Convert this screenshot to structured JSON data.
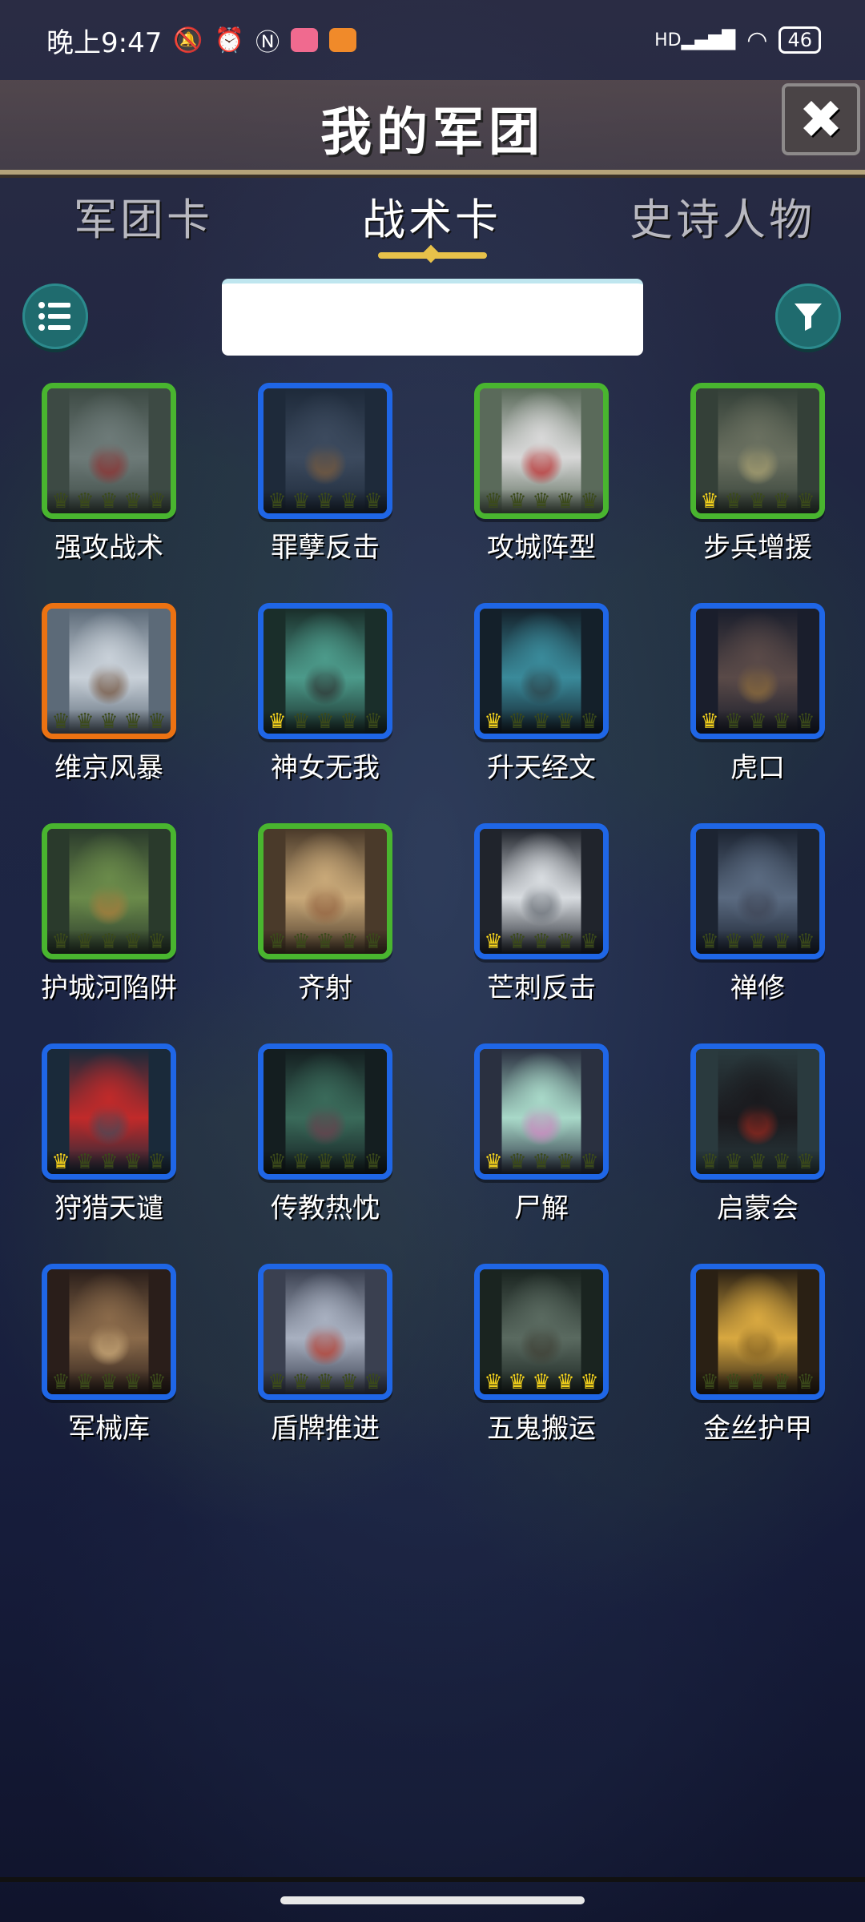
{
  "status_bar": {
    "time": "晚上9:47",
    "battery": "46",
    "network": "HD"
  },
  "header": {
    "title": "我的军团",
    "close_label": "✖"
  },
  "tabs": [
    {
      "label": "军团卡",
      "active": false
    },
    {
      "label": "战术卡",
      "active": true
    },
    {
      "label": "史诗人物",
      "active": false
    }
  ],
  "search": {
    "value": "",
    "placeholder": ""
  },
  "cards": [
    {
      "label": "强攻战术",
      "frame": "green",
      "gold_crowns": 0,
      "art": "knights-banner"
    },
    {
      "label": "罪孽反击",
      "frame": "blue",
      "gold_crowns": 0,
      "art": "dark-soldiers"
    },
    {
      "label": "攻城阵型",
      "frame": "green",
      "gold_crowns": 0,
      "art": "crusader"
    },
    {
      "label": "步兵增援",
      "frame": "green",
      "gold_crowns": 1,
      "art": "armored-infantry"
    },
    {
      "label": "维京风暴",
      "frame": "orange",
      "gold_crowns": 0,
      "art": "vikings-snow"
    },
    {
      "label": "神女无我",
      "frame": "blue",
      "gold_crowns": 1,
      "art": "goddess-hall"
    },
    {
      "label": "升天经文",
      "frame": "blue",
      "gold_crowns": 1,
      "art": "cathedral-windows"
    },
    {
      "label": "虎口",
      "frame": "blue",
      "gold_crowns": 1,
      "art": "dark-castle"
    },
    {
      "label": "护城河陷阱",
      "frame": "green",
      "gold_crowns": 0,
      "art": "moat-ruins"
    },
    {
      "label": "齐射",
      "frame": "green",
      "gold_crowns": 0,
      "art": "arrow-volley"
    },
    {
      "label": "芒刺反击",
      "frame": "blue",
      "gold_crowns": 1,
      "art": "reaper-moon"
    },
    {
      "label": "禅修",
      "frame": "blue",
      "gold_crowns": 0,
      "art": "hooded-monk"
    },
    {
      "label": "狩猎天谴",
      "frame": "blue",
      "gold_crowns": 1,
      "art": "red-storm"
    },
    {
      "label": "传教热忱",
      "frame": "blue",
      "gold_crowns": 0,
      "art": "preacher-hall"
    },
    {
      "label": "尸解",
      "frame": "blue",
      "gold_crowns": 1,
      "art": "statue-sky"
    },
    {
      "label": "启蒙会",
      "frame": "blue",
      "gold_crowns": 0,
      "art": "dark-tower"
    },
    {
      "label": "军械库",
      "frame": "blue",
      "gold_crowns": 0,
      "art": "armory"
    },
    {
      "label": "盾牌推进",
      "frame": "blue",
      "gold_crowns": 0,
      "art": "shield-knights"
    },
    {
      "label": "五鬼搬运",
      "frame": "blue",
      "gold_crowns": 5,
      "art": "ghouls"
    },
    {
      "label": "金丝护甲",
      "frame": "blue",
      "gold_crowns": 0,
      "art": "golden-armor"
    }
  ],
  "colors": {
    "frame_green": "#49b52f",
    "frame_blue": "#1f66e6",
    "frame_orange": "#ec7212",
    "crown_gold": "#f4d21c",
    "accent_teal": "#1f6b6e",
    "tab_underline": "#e7c14a"
  },
  "icons": {
    "list_button": "list-icon",
    "filter_button": "filter-icon",
    "close_button": "close-icon"
  }
}
